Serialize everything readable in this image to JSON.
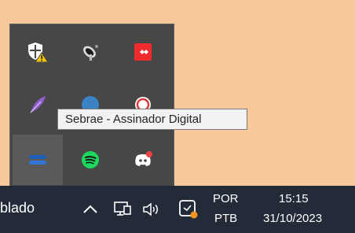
{
  "tooltip": {
    "text": "Sebrae - Assinador Digital"
  },
  "taskbar": {
    "app_label": "blado",
    "language": {
      "line1": "POR",
      "line2": "PTB"
    },
    "clock": {
      "time": "15:15",
      "date": "31/10/2023"
    }
  },
  "tray_icons": [
    {
      "name": "windows-security-warning-icon",
      "row": 1,
      "col": 1
    },
    {
      "name": "satellite-dish-icon",
      "row": 1,
      "col": 2
    },
    {
      "name": "anydesk-icon",
      "row": 1,
      "col": 3,
      "color": "#ef2b2d"
    },
    {
      "name": "feather-icon",
      "row": 2,
      "col": 1,
      "color": "#8f5dc8"
    },
    {
      "name": "blue-circle-icon",
      "row": 2,
      "col": 2,
      "color": "#3b82c4"
    },
    {
      "name": "red-circle-icon",
      "row": 2,
      "col": 3
    },
    {
      "name": "sebrae-assinador-icon",
      "row": 3,
      "col": 1,
      "color": "#1e5eb8",
      "selected": true
    },
    {
      "name": "spotify-icon",
      "row": 3,
      "col": 2,
      "color": "#1ed760"
    },
    {
      "name": "discord-icon",
      "row": 3,
      "col": 3
    }
  ],
  "system_icons": [
    "chevron-up-icon",
    "network-icon",
    "volume-icon",
    "notification-icon"
  ],
  "colors": {
    "background": "#f7c99a",
    "tray_background": "#474747",
    "taskbar": "#232a38",
    "tooltip_background": "#f2f2f2"
  }
}
